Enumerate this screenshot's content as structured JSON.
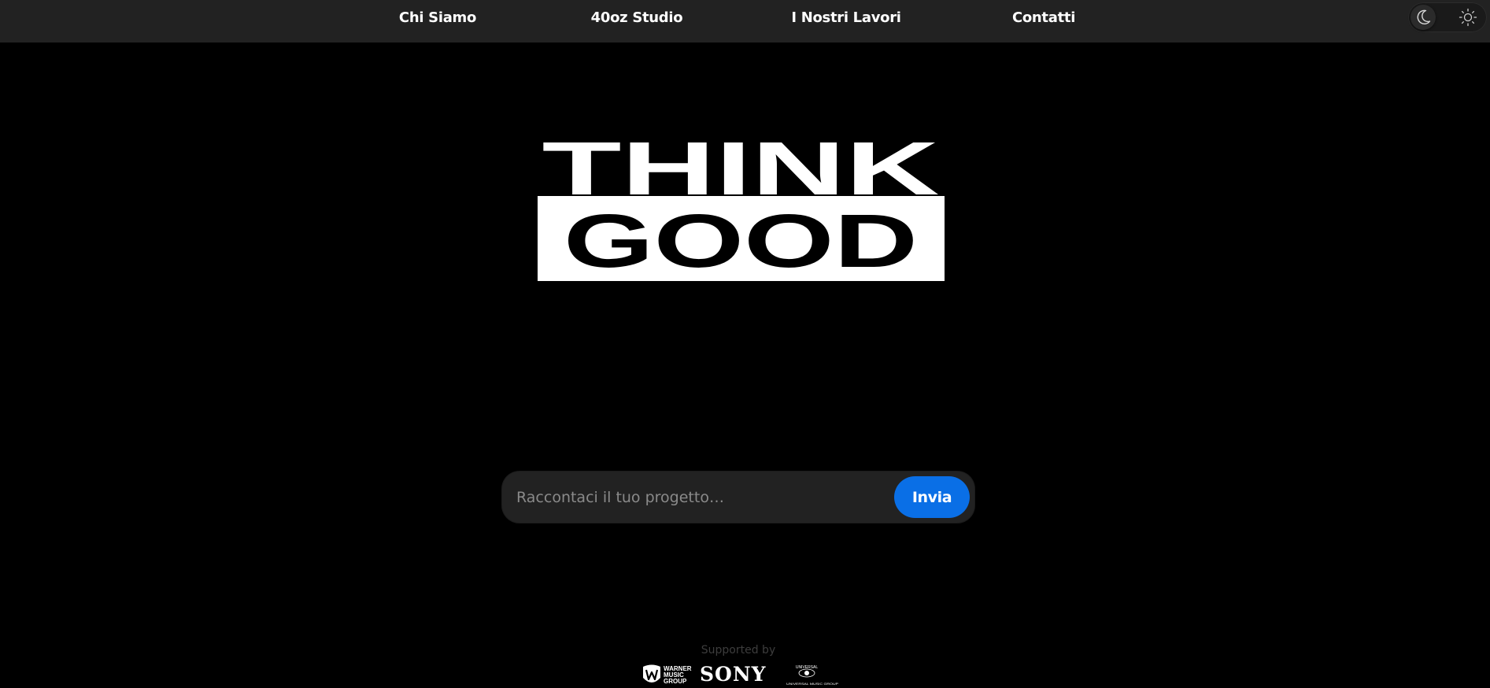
{
  "nav": {
    "items": [
      {
        "label": "Chi Siamo"
      },
      {
        "label": "40oz Studio"
      },
      {
        "label": "I Nostri Lavori"
      },
      {
        "label": "Contatti"
      }
    ]
  },
  "theme_toggle": {
    "mode": "dark",
    "left_icon": "moon-icon",
    "right_icon": "sun-icon"
  },
  "hero": {
    "logo_line1": "THINK",
    "logo_line2": "GOOD"
  },
  "prompt": {
    "placeholder": "Raccontaci il tuo progetto…",
    "value": "",
    "submit_label": "Invia"
  },
  "sponsors": {
    "heading": "Supported by",
    "logos": [
      {
        "name": "WARNER MUSIC GROUP"
      },
      {
        "name": "SONY"
      },
      {
        "name": "UNIVERSAL MUSIC GROUP"
      }
    ]
  },
  "colors": {
    "background": "#000000",
    "nav_background": "#222222",
    "accent": "#0a6fe6",
    "text": "#ffffff",
    "muted": "#3d3d3d"
  }
}
